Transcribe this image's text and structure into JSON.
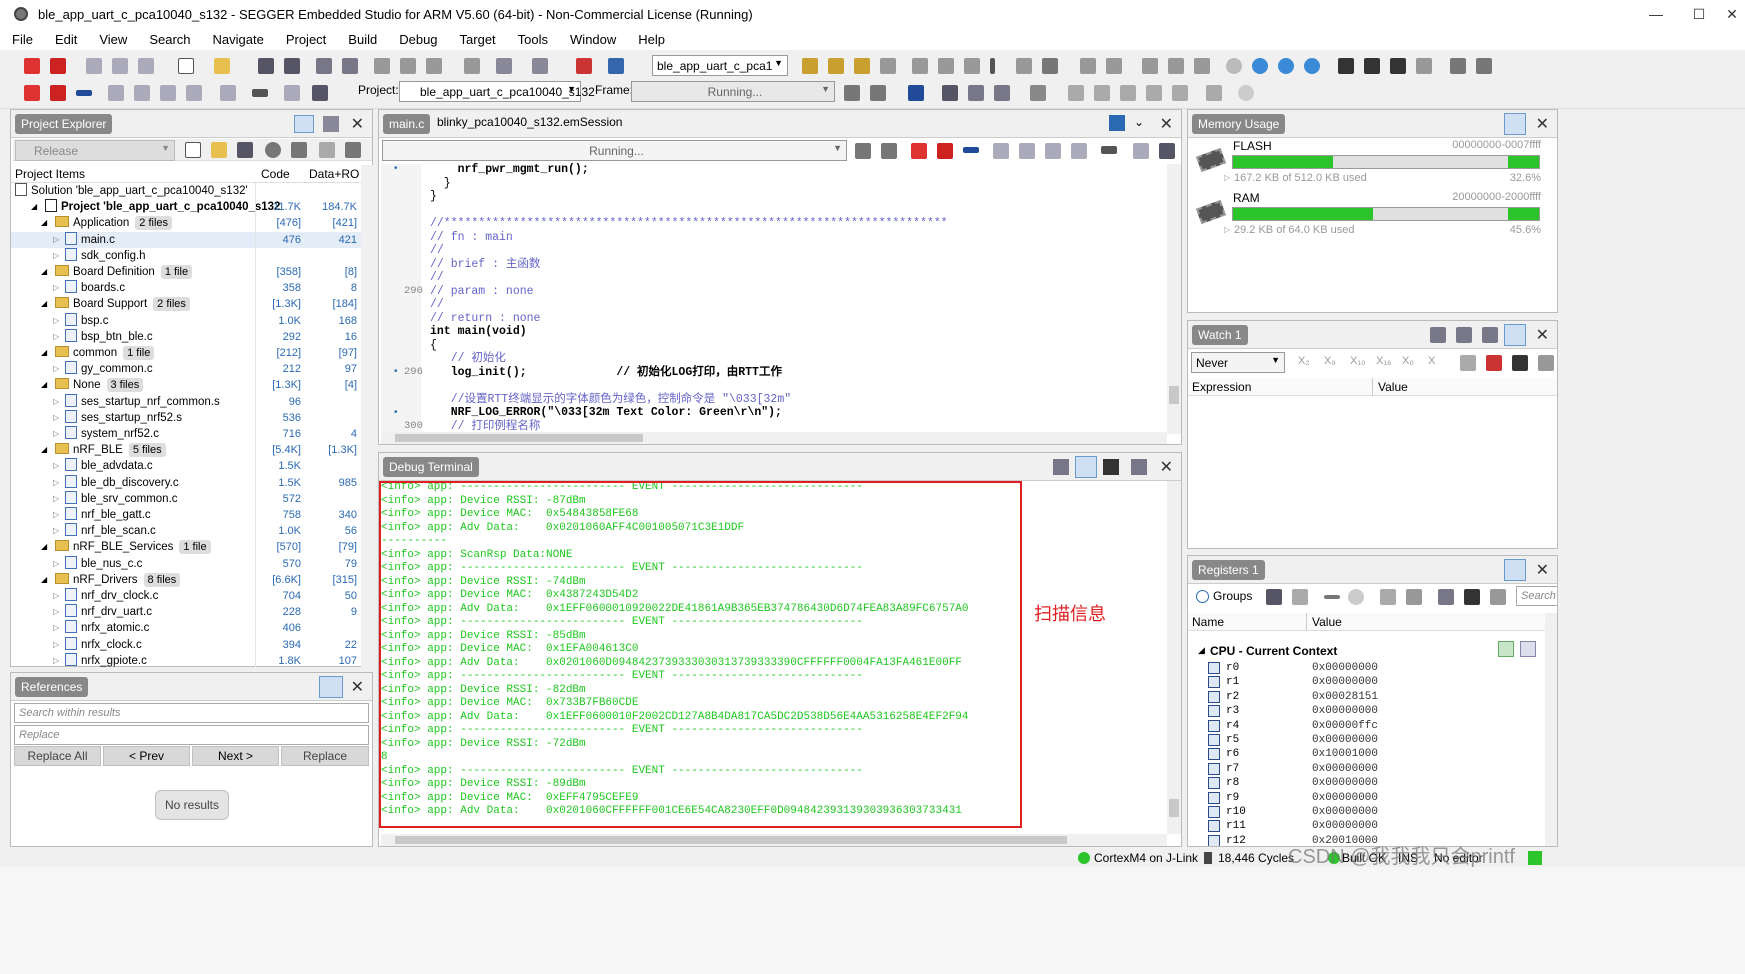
{
  "window": {
    "title": "ble_app_uart_c_pca10040_s132 - SEGGER Embedded Studio for ARM V5.60 (64-bit) - Non-Commercial License (Running)",
    "min_label": "—",
    "max_label": "☐",
    "close_label": "✕"
  },
  "menu": [
    "File",
    "Edit",
    "View",
    "Search",
    "Navigate",
    "Project",
    "Build",
    "Debug",
    "Target",
    "Tools",
    "Window",
    "Help"
  ],
  "toolbar": {
    "config_combo": "ble_app_uart_c_pca1",
    "project_label": "Project:",
    "project_combo": "ble_app_uart_c_pca10040_s132",
    "frame_label": "Frame:",
    "frame_combo": "Running..."
  },
  "project_explorer": {
    "tab": "Project Explorer",
    "release": "Release",
    "headers": {
      "items": "Project Items",
      "code": "Code",
      "data": "Data+RO"
    },
    "rows": [
      {
        "indent": 0,
        "kind": "solution",
        "label": "Solution 'ble_app_uart_c_pca10040_s132'",
        "code": "",
        "data": "",
        "bold": false
      },
      {
        "indent": 1,
        "kind": "project",
        "label": "Project 'ble_app_uart_c_pca10040_s132",
        "code": "11.7K",
        "data": "184.7K",
        "bold": true
      },
      {
        "indent": 2,
        "kind": "folder",
        "label": "Application",
        "badge": "2 files",
        "code": "[476]",
        "data": "[421]"
      },
      {
        "indent": 3,
        "kind": "file",
        "label": "main.c",
        "code": "476",
        "data": "421",
        "selected": true
      },
      {
        "indent": 3,
        "kind": "file",
        "label": "sdk_config.h",
        "code": "",
        "data": ""
      },
      {
        "indent": 2,
        "kind": "folder",
        "label": "Board Definition",
        "badge": "1 file",
        "code": "[358]",
        "data": "[8]"
      },
      {
        "indent": 3,
        "kind": "file",
        "label": "boards.c",
        "code": "358",
        "data": "8"
      },
      {
        "indent": 2,
        "kind": "folder",
        "label": "Board Support",
        "badge": "2 files",
        "code": "[1.3K]",
        "data": "[184]"
      },
      {
        "indent": 3,
        "kind": "file",
        "label": "bsp.c",
        "code": "1.0K",
        "data": "168"
      },
      {
        "indent": 3,
        "kind": "file",
        "label": "bsp_btn_ble.c",
        "code": "292",
        "data": "16"
      },
      {
        "indent": 2,
        "kind": "folder",
        "label": "common",
        "badge": "1 file",
        "code": "[212]",
        "data": "[97]"
      },
      {
        "indent": 3,
        "kind": "file",
        "label": "gy_common.c",
        "code": "212",
        "data": "97"
      },
      {
        "indent": 2,
        "kind": "folder",
        "label": "None",
        "badge": "3 files",
        "code": "[1.3K]",
        "data": "[4]"
      },
      {
        "indent": 3,
        "kind": "asm",
        "label": "ses_startup_nrf_common.s",
        "code": "96",
        "data": ""
      },
      {
        "indent": 3,
        "kind": "asm",
        "label": "ses_startup_nrf52.s",
        "code": "536",
        "data": ""
      },
      {
        "indent": 3,
        "kind": "file",
        "label": "system_nrf52.c",
        "code": "716",
        "data": "4"
      },
      {
        "indent": 2,
        "kind": "folder",
        "label": "nRF_BLE",
        "badge": "5 files",
        "code": "[5.4K]",
        "data": "[1.3K]"
      },
      {
        "indent": 3,
        "kind": "file",
        "label": "ble_advdata.c",
        "code": "1.5K",
        "data": ""
      },
      {
        "indent": 3,
        "kind": "file",
        "label": "ble_db_discovery.c",
        "code": "1.5K",
        "data": "985"
      },
      {
        "indent": 3,
        "kind": "file",
        "label": "ble_srv_common.c",
        "code": "572",
        "data": ""
      },
      {
        "indent": 3,
        "kind": "file",
        "label": "nrf_ble_gatt.c",
        "code": "758",
        "data": "340"
      },
      {
        "indent": 3,
        "kind": "file",
        "label": "nrf_ble_scan.c",
        "code": "1.0K",
        "data": "56"
      },
      {
        "indent": 2,
        "kind": "folder",
        "label": "nRF_BLE_Services",
        "badge": "1 file",
        "code": "[570]",
        "data": "[79]"
      },
      {
        "indent": 3,
        "kind": "file",
        "label": "ble_nus_c.c",
        "code": "570",
        "data": "79"
      },
      {
        "indent": 2,
        "kind": "folder",
        "label": "nRF_Drivers",
        "badge": "8 files",
        "code": "[6.6K]",
        "data": "[315]"
      },
      {
        "indent": 3,
        "kind": "file",
        "label": "nrf_drv_clock.c",
        "code": "704",
        "data": "50"
      },
      {
        "indent": 3,
        "kind": "file",
        "label": "nrf_drv_uart.c",
        "code": "228",
        "data": "9"
      },
      {
        "indent": 3,
        "kind": "file",
        "label": "nrfx_atomic.c",
        "code": "406",
        "data": ""
      },
      {
        "indent": 3,
        "kind": "file",
        "label": "nrfx_clock.c",
        "code": "394",
        "data": "22"
      },
      {
        "indent": 3,
        "kind": "file",
        "label": "nrfx_gpiote.c",
        "code": "1.8K",
        "data": "107"
      }
    ]
  },
  "references": {
    "tab": "References",
    "search_placeholder": "Search within results",
    "replace_placeholder": "Replace",
    "buttons": [
      "Replace All",
      "< Prev",
      "Next >",
      "Replace"
    ],
    "no_results": "No results"
  },
  "editor": {
    "tabs": [
      "main.c",
      "blinky_pca10040_s132.emSession"
    ],
    "status_combo": "Running...",
    "line_numbers": {
      "l1": "290",
      "l2": "296",
      "l3": "300"
    },
    "lines": [
      {
        "text": "    nrf_pwr_mgmt_run();",
        "color": "#000",
        "bold": true
      },
      {
        "text": "  }",
        "color": "#000",
        "bold": false
      },
      {
        "text": "}",
        "color": "#000",
        "bold": false
      },
      {
        "text": "",
        "color": "#000",
        "bold": false
      },
      {
        "text": "//*************************************************************************",
        "color": "#6464c8",
        "bold": false
      },
      {
        "text": "// fn : main",
        "color": "#6464c8",
        "bold": false
      },
      {
        "text": "//",
        "color": "#6464c8",
        "bold": false
      },
      {
        "text": "// brief : 主函数",
        "color": "#6464c8",
        "bold": false
      },
      {
        "text": "//",
        "color": "#6464c8",
        "bold": false
      },
      {
        "text": "// param : none",
        "color": "#6464c8",
        "bold": false
      },
      {
        "text": "//",
        "color": "#6464c8",
        "bold": false
      },
      {
        "text": "// return : none",
        "color": "#6464c8",
        "bold": false
      },
      {
        "text": "int main(void)",
        "color": "#000",
        "bold": true
      },
      {
        "text": "{",
        "color": "#000",
        "bold": false
      },
      {
        "text": "   // 初始化",
        "color": "#6464c8",
        "bold": false
      },
      {
        "text": "   log_init();             // 初始化LOG打印，由RTT工作",
        "color": "#000",
        "bold": true
      },
      {
        "text": "",
        "color": "#000",
        "bold": false
      },
      {
        "text": "   //设置RTT终端显示的字体颜色为绿色，控制命令是 \"\\033[32m\"",
        "color": "#6464c8",
        "bold": false
      },
      {
        "text": "   NRF_LOG_ERROR(\"\\033[32m Text Color: Green\\r\\n\");",
        "color": "#000",
        "bold": true
      },
      {
        "text": "   // 打印例程名称",
        "color": "#6464c8",
        "bold": false
      }
    ]
  },
  "debug_terminal": {
    "tab": "Debug Terminal",
    "annotation": "扫描信息",
    "lines": [
      "<info> app: ------------------------- EVENT -----------------------------",
      "<info> app: Device RSSI: -87dBm",
      "<info> app: Device MAC:  0x54843858FE68",
      "<info> app: Adv Data:    0x0201060AFF4C001005071C3E1DDF",
      "----------",
      "<info> app: ScanRsp Data:NONE",
      "<info> app: ------------------------- EVENT -----------------------------",
      "<info> app: Device RSSI: -74dBm",
      "<info> app: Device MAC:  0x4387243D54D2",
      "<info> app: Adv Data:    0x1EFF0600010920022DE41861A9B365EB374786430D6D74FEA83A89FC6757A0",
      "<info> app: ------------------------- EVENT -----------------------------",
      "<info> app: Device RSSI: -85dBm",
      "<info> app: Device MAC:  0x1EFA004613C0",
      "<info> app: Adv Data:    0x0201060D0948423739333030313739333390CFFFFFF0004FA13FA461E00FF",
      "<info> app: ------------------------- EVENT -----------------------------",
      "<info> app: Device RSSI: -82dBm",
      "<info> app: Device MAC:  0x733B7FB60CDE",
      "<info> app: Adv Data:    0x1EFF0600010F2002CD127A8B4DA817CA5DC2D538D56E4AA5316258E4EF2F94",
      "<info> app: ------------------------- EVENT -----------------------------",
      "<info> app: Device RSSI: -72dBm",
      "8",
      "<info> app: ------------------------- EVENT -----------------------------",
      "<info> app: Device RSSI: -89dBm",
      "<info> app: Device MAC:  0xEFF4795CEFE9",
      "<info> app: Adv Data:    0x0201060CFFFFFF001CE6E54CA8230EFF0D094842393139303936303733431"
    ]
  },
  "memory": {
    "tab": "Memory Usage",
    "items": [
      {
        "name": "FLASH",
        "range": "00000000-0007ffff",
        "used": "167.2 KB of 512.0 KB used",
        "percent_text": "32.6%",
        "percent": 32.6,
        "light_percent": 90
      },
      {
        "name": "RAM",
        "range": "20000000-2000ffff",
        "used": "29.2 KB of 64.0 KB used",
        "percent_text": "45.6%",
        "percent": 45.6,
        "light_percent": 90
      }
    ]
  },
  "watch": {
    "tab": "Watch 1",
    "mode": "Never",
    "fmt_buttons": [
      "X₂",
      "X₈",
      "X₁₀",
      "X₁₆",
      "X₀",
      "X"
    ],
    "headers": {
      "expression": "Expression",
      "value": "Value"
    }
  },
  "registers": {
    "tab": "Registers 1",
    "groups": "Groups",
    "search_placeholder": "Search R",
    "headers": {
      "name": "Name",
      "value": "Value"
    },
    "group_title": "CPU - Current Context",
    "regs": [
      {
        "name": "r0",
        "value": "0x00000000"
      },
      {
        "name": "r1",
        "value": "0x00000000"
      },
      {
        "name": "r2",
        "value": "0x00028151"
      },
      {
        "name": "r3",
        "value": "0x00000000"
      },
      {
        "name": "r4",
        "value": "0x00000ffc"
      },
      {
        "name": "r5",
        "value": "0x00000000"
      },
      {
        "name": "r6",
        "value": "0x10001000"
      },
      {
        "name": "r7",
        "value": "0x00000000"
      },
      {
        "name": "r8",
        "value": "0x00000000"
      },
      {
        "name": "r9",
        "value": "0x00000000"
      },
      {
        "name": "r10",
        "value": "0x00000000"
      },
      {
        "name": "r11",
        "value": "0x00000000"
      },
      {
        "name": "r12",
        "value": "0x20010000"
      }
    ]
  },
  "statusbar": {
    "target": "CortexM4 on J-Link",
    "cycles": "18,446 Cycles",
    "build": "Built OK",
    "ins": "INS",
    "editor": "No editor",
    "watermark": "CSDN @我我我只会printf"
  },
  "colors": {
    "terminal_text": "#1ec81e",
    "annotation": "#e02020",
    "highlight_box": "#e02020",
    "bar_green": "#2bc42b"
  }
}
